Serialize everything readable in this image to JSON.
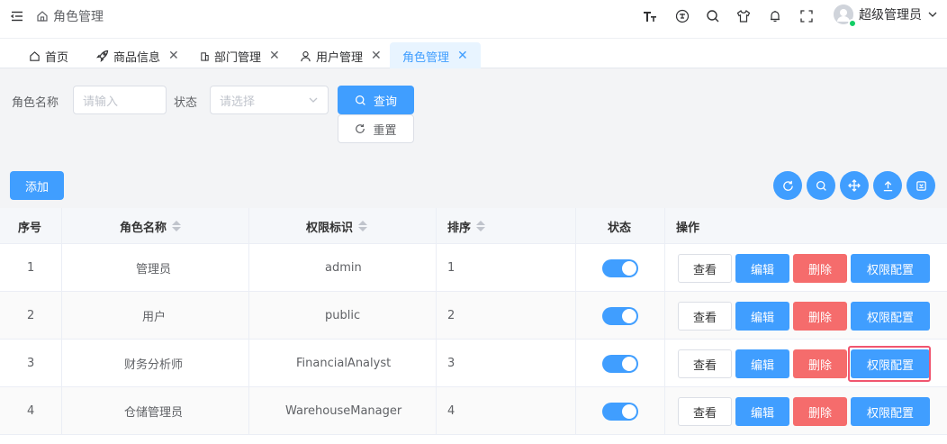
{
  "header": {
    "breadcrumb": "角色管理",
    "username": "超级管理员"
  },
  "tabs": [
    {
      "label": "首页",
      "icon": "home-icon",
      "closable": false
    },
    {
      "label": "商品信息",
      "icon": "rocket-icon",
      "closable": true
    },
    {
      "label": "部门管理",
      "icon": "building-icon",
      "closable": true
    },
    {
      "label": "用户管理",
      "icon": "user-icon",
      "closable": true
    },
    {
      "label": "角色管理",
      "icon": "",
      "closable": true,
      "active": true
    }
  ],
  "search": {
    "role_name_label": "角色名称",
    "role_name_placeholder": "请输入",
    "status_label": "状态",
    "status_placeholder": "请选择",
    "query_label": "查询",
    "reset_label": "重置"
  },
  "toolbar": {
    "add_label": "添加",
    "icons": [
      "refresh-icon",
      "search-icon",
      "move-icon",
      "upload-icon",
      "export-icon"
    ]
  },
  "table": {
    "headers": {
      "index": "序号",
      "role_name": "角色名称",
      "permission": "权限标识",
      "sort": "排序",
      "status": "状态",
      "actions": "操作"
    },
    "rows": [
      {
        "index": "1",
        "role_name": "管理员",
        "permission": "admin",
        "sort": "1",
        "status_on": true
      },
      {
        "index": "2",
        "role_name": "用户",
        "permission": "public",
        "sort": "2",
        "status_on": true
      },
      {
        "index": "3",
        "role_name": "财务分析师",
        "permission": "FinancialAnalyst",
        "sort": "3",
        "status_on": true
      },
      {
        "index": "4",
        "role_name": "仓储管理员",
        "permission": "WarehouseManager",
        "sort": "4",
        "status_on": true
      }
    ],
    "action_labels": {
      "view": "查看",
      "edit": "编辑",
      "delete": "删除",
      "permission": "权限配置"
    }
  },
  "colors": {
    "primary": "#409eff",
    "danger": "#f56c6c",
    "highlight": "#f0556f",
    "online": "#13ce66"
  }
}
